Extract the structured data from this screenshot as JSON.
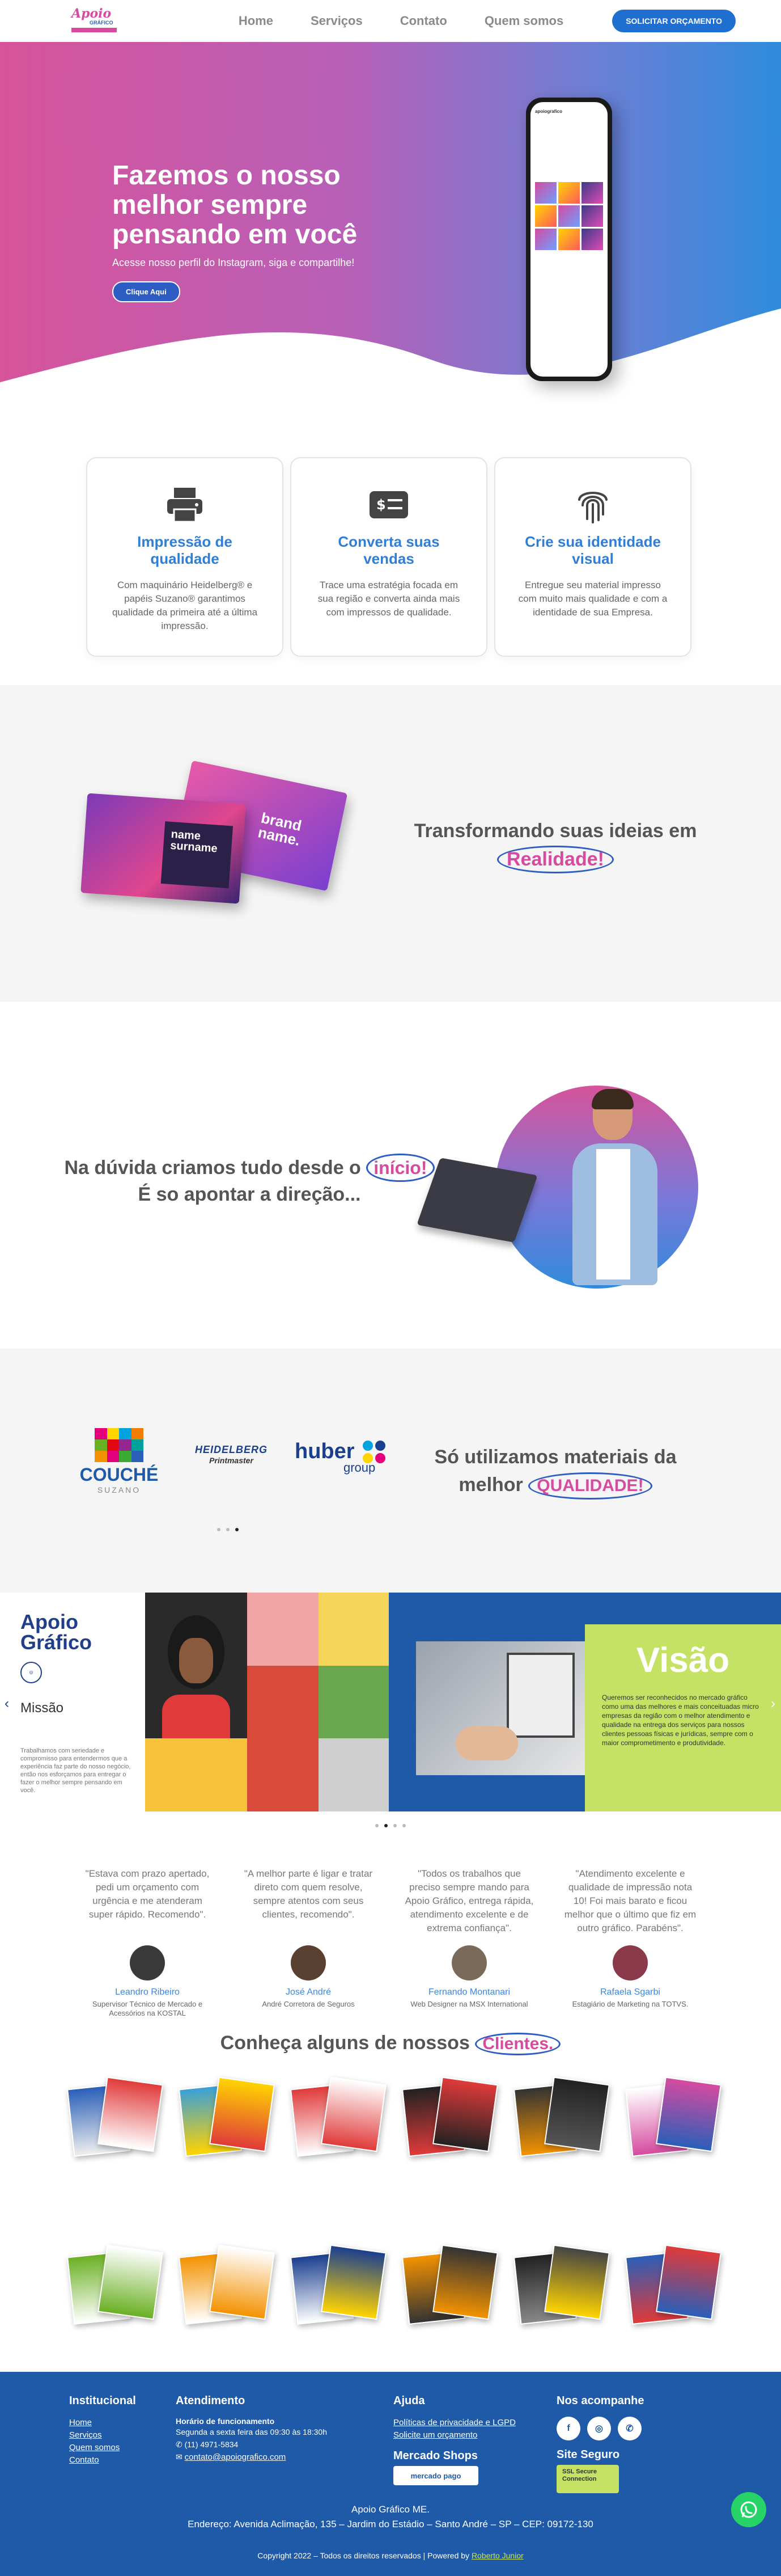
{
  "nav": {
    "logo_text": "Apoio",
    "logo_sub": "GRÁFICO",
    "links": [
      "Home",
      "Serviços",
      "Contato",
      "Quem somos"
    ],
    "cta": "SOLICITAR ORÇAMENTO"
  },
  "hero": {
    "title": "Fazemos o nosso melhor sempre pensando em você",
    "subtitle": "Acesse nosso perfil do Instagram, siga e compartilhe!",
    "button": "Clique Aqui",
    "phone_handle": "apoiografico"
  },
  "features": [
    {
      "icon": "printer-icon",
      "title": "Impressão de qualidade",
      "text": "Com maquinário Heidelberg® e papéis Suzano® garantimos qualidade da primeira até a última impressão."
    },
    {
      "icon": "money-icon",
      "title": "Converta suas vendas",
      "text": "Trace uma estratégia focada em sua região e converta ainda mais com impressos de qualidade."
    },
    {
      "icon": "fingerprint-icon",
      "title": "Crie sua identidade visual",
      "text": "Entregue seu material impresso com muito mais qualidade e com a identidade de sua Empresa."
    }
  ],
  "ideas": {
    "text": "Transformando suas ideias em",
    "highlight": "Realidade!",
    "card_name": "name surname",
    "card_brand": "brand name."
  },
  "doubt": {
    "line1": "Na dúvida criamos tudo desde o",
    "highlight": "início!",
    "line2": "É so apontar a direção..."
  },
  "brands": {
    "couche": "COUCHÉ",
    "suzano": "SUZANO",
    "heidelberg": "HEIDELBERG",
    "printmaster": "Printmaster",
    "huber": "huber",
    "group": "group",
    "text": "Só utilizamos materiais da melhor",
    "highlight": "QUALIDADE!"
  },
  "slider": {
    "brand_title": "Apoio Gráfico",
    "mission_label": "Missão",
    "mission_text": "Trabalhamos com seriedade e compromisso para entendermos que a experiência faz parte do nosso negócio, então nos esforçamos para entregar o fazer o melhor sempre pensando em você.",
    "vision_title": "Visão",
    "vision_text": "Queremos ser reconhecidos no mercado gráfico como uma das melhores e mais conceituadas micro empresas da região com o melhor atendimento e qualidade na entrega dos serviços para nossos clientes pessoas físicas e jurídicas, sempre com o maior comprometimento e produtividade."
  },
  "testimonials": [
    {
      "quote": "\"Estava com prazo apertado, pedi um orçamento com urgência e me atenderam super rápido. Recomendo\".",
      "name": "Leandro Ribeiro",
      "role": "Supervisor Técnico de Mercado e Acessórios na KOSTAL"
    },
    {
      "quote": "\"A melhor parte é ligar e tratar direto com quem resolve, sempre atentos com seus clientes, recomendo\".",
      "name": "José André",
      "role": "André Corretora de Seguros"
    },
    {
      "quote": "\"Todos os trabalhos que preciso sempre mando para Apoio Gráfico, entrega rápida, atendimento excelente e de extrema confiança\".",
      "name": "Fernando Montanari",
      "role": "Web Designer na MSX International"
    },
    {
      "quote": "\"Atendimento excelente e qualidade de impressão nota 10! Foi mais barato e ficou melhor que o último que fiz em outro gráfico. Parabéns\".",
      "name": "Rafaela Sgarbi",
      "role": "Estagiário de Marketing na TOTVS."
    }
  ],
  "clients": {
    "title": "Conheça alguns de nossos",
    "highlight": "Clientes."
  },
  "footer": {
    "inst_title": "Institucional",
    "inst_links": [
      "Home",
      "Serviços",
      "Quem somos",
      "Contato"
    ],
    "att_title": "Atendimento",
    "hours_label": "Horário de funcionamento",
    "hours": "Segunda a sexta feira das 09:30 às 18:30h",
    "phone": "(11) 4971-5834",
    "email": "contato@apoiografico.com",
    "help_title": "Ajuda",
    "help_links": [
      "Políticas de privacidade e LGPD",
      "Solicite um orçamento"
    ],
    "shops_title": "Mercado Shops",
    "mp_badge": "mercado pago",
    "follow_title": "Nos acompanhe",
    "secure_title": "Site Seguro",
    "ssl_badge": "SSL Secure Connection",
    "company": "Apoio Gráfico ME.",
    "address": "Endereço: Avenida Aclimação, 135 – Jardim do Estádio – Santo André – SP – CEP: 09172-130",
    "copyright": "Copyright 2022 – Todos os direitos reservados | Powered by",
    "powered_by": "Roberto Junior"
  }
}
